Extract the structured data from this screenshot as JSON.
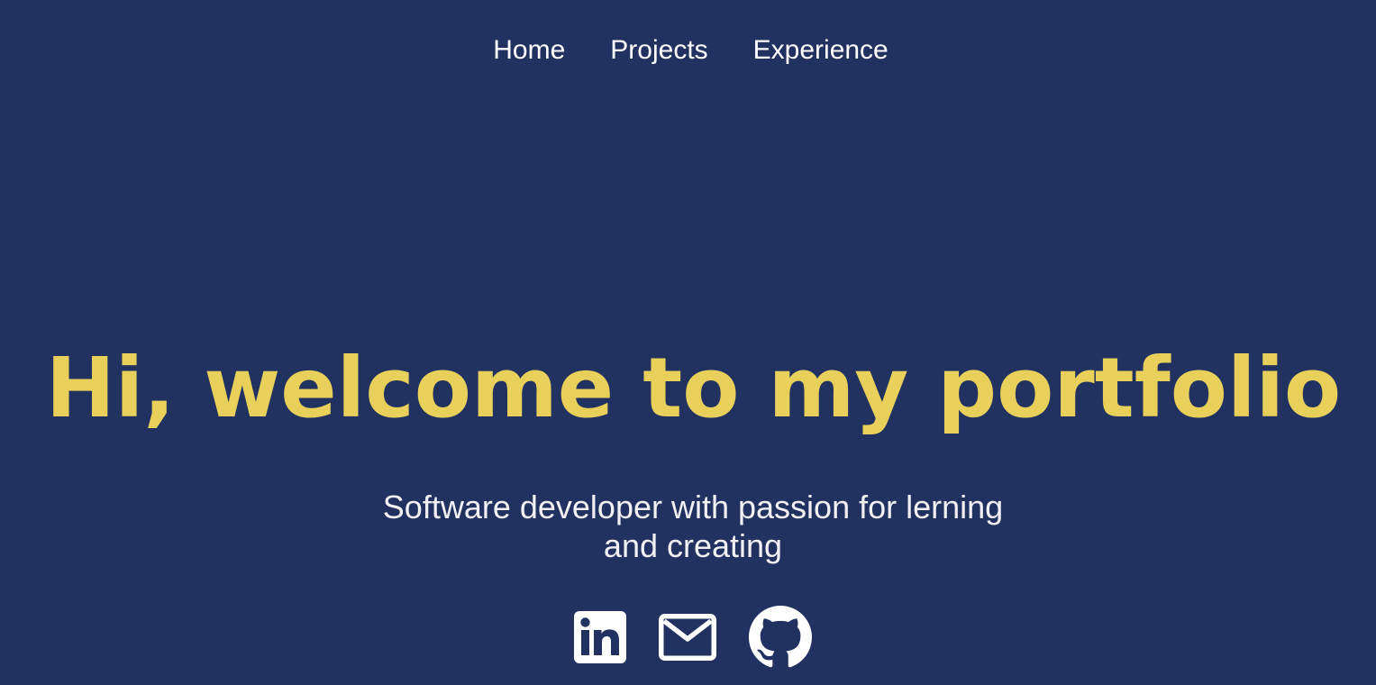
{
  "nav": {
    "items": [
      {
        "label": "Home"
      },
      {
        "label": "Projects"
      },
      {
        "label": "Experience"
      }
    ]
  },
  "hero": {
    "title": "Hi, welcome to my portfolio",
    "subtitle": "Software developer with passion for lerning and creating"
  },
  "social": {
    "icons": [
      "linkedin-icon",
      "mail-icon",
      "github-icon"
    ]
  },
  "colors": {
    "background": "#223260",
    "accent": "#e9d05a",
    "text": "#ffffff"
  }
}
